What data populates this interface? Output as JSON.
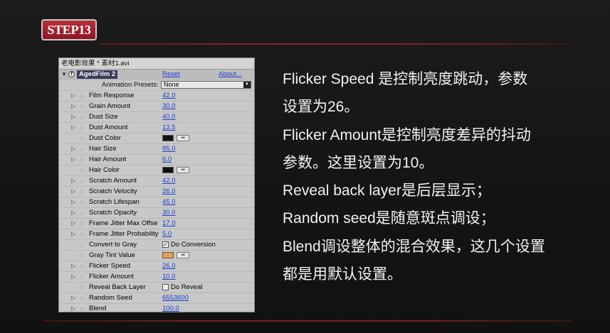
{
  "step_label": "STEP13",
  "panel": {
    "title": "老电影效果 * 素材1.avi",
    "effect_name": "AgedFilm 2",
    "effect_icon": "fx-icon",
    "reset_label": "Reset",
    "about_label": "About...",
    "presets_label": "Animation Presets:",
    "presets_value": "None"
  },
  "properties": [
    {
      "name": "Film Response",
      "type": "value",
      "value": "42.0",
      "twirl": true
    },
    {
      "name": "Grain Amount",
      "type": "value",
      "value": "30.0",
      "twirl": true
    },
    {
      "name": "Dust Size",
      "type": "value",
      "value": "40.0",
      "twirl": true
    },
    {
      "name": "Dust Amount",
      "type": "value",
      "value": "13.5",
      "twirl": true
    },
    {
      "name": "Dust Color",
      "type": "color",
      "color": "#111111",
      "twirl": false
    },
    {
      "name": "Hair Size",
      "type": "value",
      "value": "85.0",
      "twirl": true
    },
    {
      "name": "Hair Amount",
      "type": "value",
      "value": "6.0",
      "twirl": true
    },
    {
      "name": "Hair Color",
      "type": "color",
      "color": "#111111",
      "twirl": false
    },
    {
      "name": "Scratch Amount",
      "type": "value",
      "value": "42.0",
      "twirl": true
    },
    {
      "name": "Scratch Velocity",
      "type": "value",
      "value": "26.0",
      "twirl": true
    },
    {
      "name": "Scratch Lifespan",
      "type": "value",
      "value": "45.0",
      "twirl": true
    },
    {
      "name": "Scratch Opacity",
      "type": "value",
      "value": "30.0",
      "twirl": true
    },
    {
      "name": "Frame Jitter Max Offse",
      "type": "value",
      "value": "17.0",
      "twirl": true
    },
    {
      "name": "Frame Jitter Probability",
      "type": "value",
      "value": "5.0",
      "twirl": true
    },
    {
      "name": "Convert to Gray",
      "type": "checkbox",
      "checked": true,
      "label": "Do Conversion",
      "twirl": false
    },
    {
      "name": "Gray Tint Value",
      "type": "color",
      "color": "#e8a04a",
      "twirl": false
    },
    {
      "name": "Flicker Speed",
      "type": "value",
      "value": "26.0",
      "twirl": true
    },
    {
      "name": "Flicker Amount",
      "type": "value",
      "value": "10.0",
      "twirl": true
    },
    {
      "name": "Reveal Back Layer",
      "type": "checkbox",
      "checked": false,
      "label": "Do Reveal",
      "twirl": false
    },
    {
      "name": "Random Seed",
      "type": "value",
      "value": "6553600",
      "twirl": true
    },
    {
      "name": "Blend",
      "type": "value",
      "value": "100.0",
      "twirl": true
    }
  ],
  "description": [
    "Flicker Speed 是控制亮度跳动，参数",
    "设置为26。",
    "Flicker Amount是控制亮度差异的抖动",
    "参数。这里设置为10。",
    "Reveal back layer是后层显示；",
    "Random seed是随意斑点调设；",
    "Blend调设整体的混合效果，这几个设置",
    "都是用默认设置。"
  ],
  "colors": {
    "badge": "#a3202e",
    "accent_line": "#7a2424",
    "link_blue": "#1a3fd0"
  }
}
